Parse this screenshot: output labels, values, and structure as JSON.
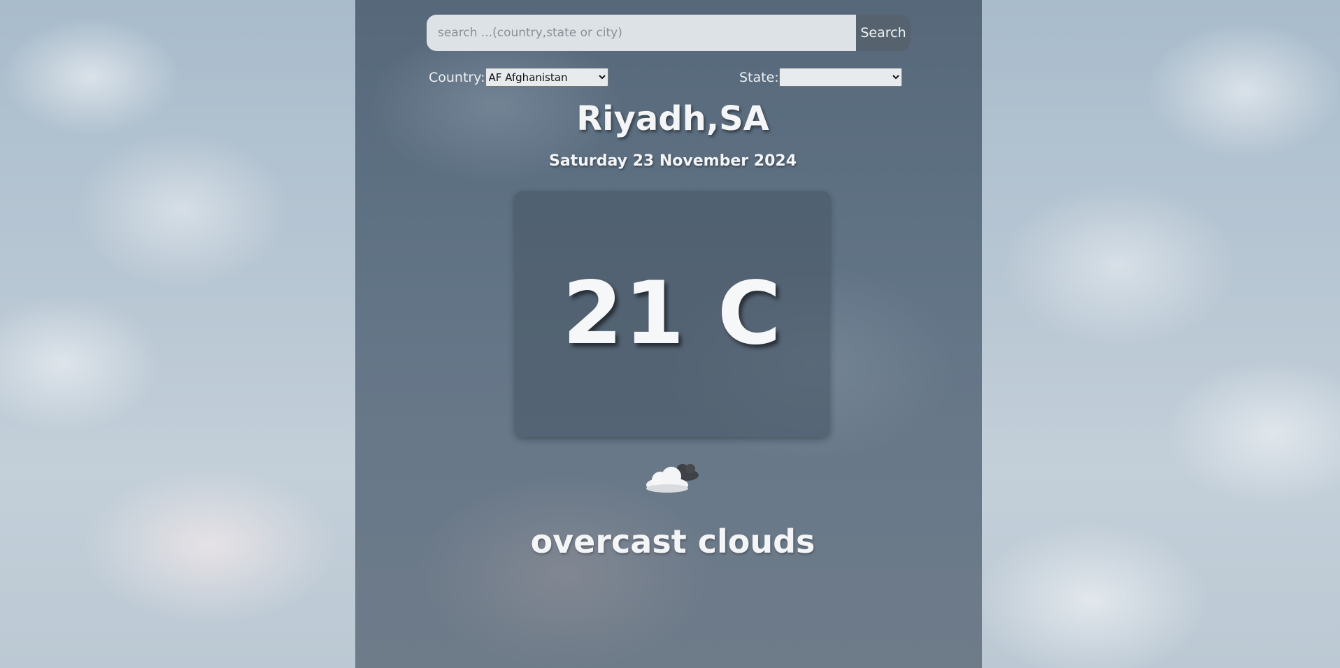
{
  "search": {
    "placeholder": "search ...(country,state or city)",
    "value": "",
    "button_label": "Search"
  },
  "filters": {
    "country_label": "Country:",
    "country_selected": "AF Afghanistan",
    "state_label": "State:",
    "state_selected": ""
  },
  "weather": {
    "location": "Riyadh,SA",
    "date": "Saturday 23 November 2024",
    "temperature": "21 C",
    "icon": "broken-clouds-icon",
    "condition": "overcast clouds"
  },
  "colors": {
    "panel": "#5f7284",
    "text": "#f4f5f7",
    "search_bg": "#dde2e7",
    "search_button_bg": "#56636f"
  }
}
